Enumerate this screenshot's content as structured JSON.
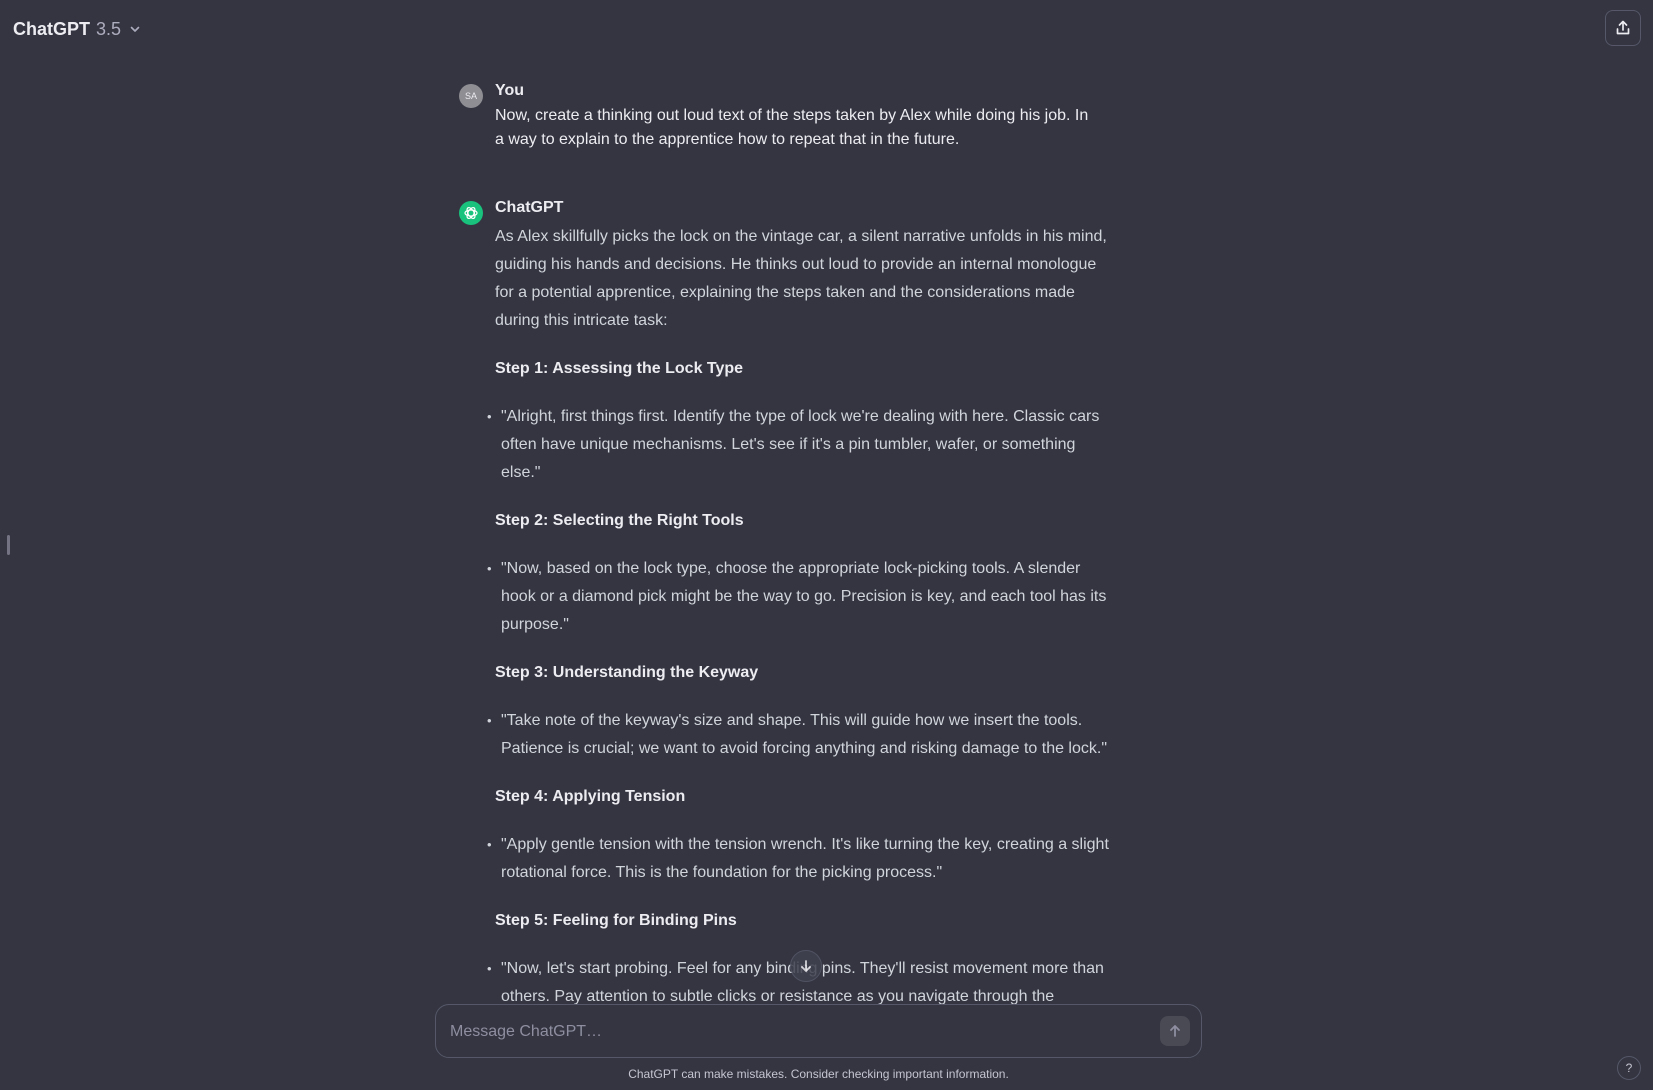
{
  "header": {
    "model_name": "ChatGPT",
    "model_version": "3.5",
    "share_icon": "share-icon",
    "dropdown_icon": "chevron-down-icon"
  },
  "conversation": {
    "user_message": {
      "avatar_initials": "SA",
      "author": "You",
      "text": "Now, create a thinking out loud text of the steps taken by Alex while doing his job. In a way to explain to the apprentice how to repeat that in the future."
    },
    "assistant_message": {
      "author": "ChatGPT",
      "intro": "As Alex skillfully picks the lock on the vintage car, a silent narrative unfolds in his mind, guiding his hands and decisions. He thinks out loud to provide an internal monologue for a potential apprentice, explaining the steps taken and the considerations made during this intricate task:",
      "steps": [
        {
          "heading": "Step 1: Assessing the Lock Type",
          "bullet": "\"Alright, first things first. Identify the type of lock we're dealing with here. Classic cars often have unique mechanisms. Let's see if it's a pin tumbler, wafer, or something else.\""
        },
        {
          "heading": "Step 2: Selecting the Right Tools",
          "bullet": "\"Now, based on the lock type, choose the appropriate lock-picking tools. A slender hook or a diamond pick might be the way to go. Precision is key, and each tool has its purpose.\""
        },
        {
          "heading": "Step 3: Understanding the Keyway",
          "bullet": "\"Take note of the keyway's size and shape. This will guide how we insert the tools. Patience is crucial; we want to avoid forcing anything and risking damage to the lock.\""
        },
        {
          "heading": "Step 4: Applying Tension",
          "bullet": "\"Apply gentle tension with the tension wrench. It's like turning the key, creating a slight rotational force. This is the foundation for the picking process.\""
        },
        {
          "heading": "Step 5: Feeling for Binding Pins",
          "bullet": "\"Now, let's start probing. Feel for any binding pins. They'll resist movement more than others. Pay attention to subtle clicks or resistance as you navigate through the"
        }
      ]
    }
  },
  "composer": {
    "placeholder": "Message ChatGPT…",
    "send_icon": "arrow-up-icon"
  },
  "footer": {
    "disclaimer": "ChatGPT can make mistakes. Consider checking important information.",
    "help_label": "?"
  },
  "colors": {
    "background": "#343541",
    "accent": "#19c37d",
    "text": "#ececf1"
  }
}
